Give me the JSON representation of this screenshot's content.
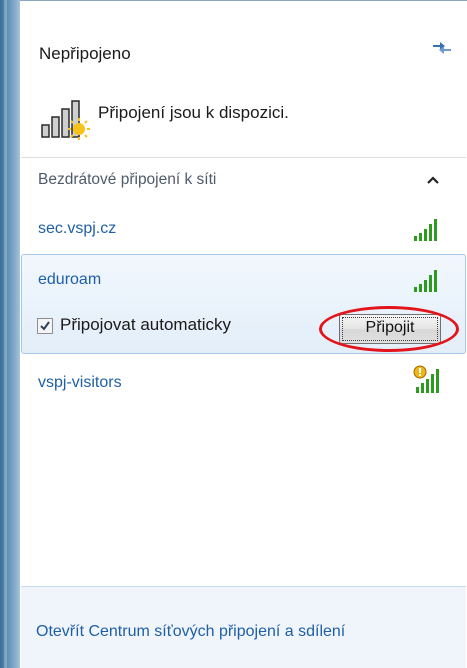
{
  "status": {
    "title": "Nepřipojeno",
    "message": "Připojení jsou k dispozici.",
    "refresh_icon": "refresh-arrows-icon"
  },
  "section": {
    "header": "Bezdrátové připojení k síti",
    "collapse_icon": "chevron-up-icon"
  },
  "networks": [
    {
      "name": "sec.vspj.cz",
      "signal_icon": "signal-bars-icon",
      "selected": false
    },
    {
      "name": "eduroam",
      "signal_icon": "signal-bars-icon",
      "selected": true,
      "auto_connect_label": "Připojovat automaticky",
      "auto_connect_checked": true,
      "connect_button": "Připojit"
    },
    {
      "name": "vspj-visitors",
      "signal_icon": "signal-bars-warning-icon",
      "selected": false
    }
  ],
  "footer": {
    "link": "Otevřít Centrum síťových připojení a sdílení"
  },
  "colors": {
    "link": "#1f5fa6",
    "annotation": "#e3151c",
    "signal_green": "#2e9a1f"
  }
}
